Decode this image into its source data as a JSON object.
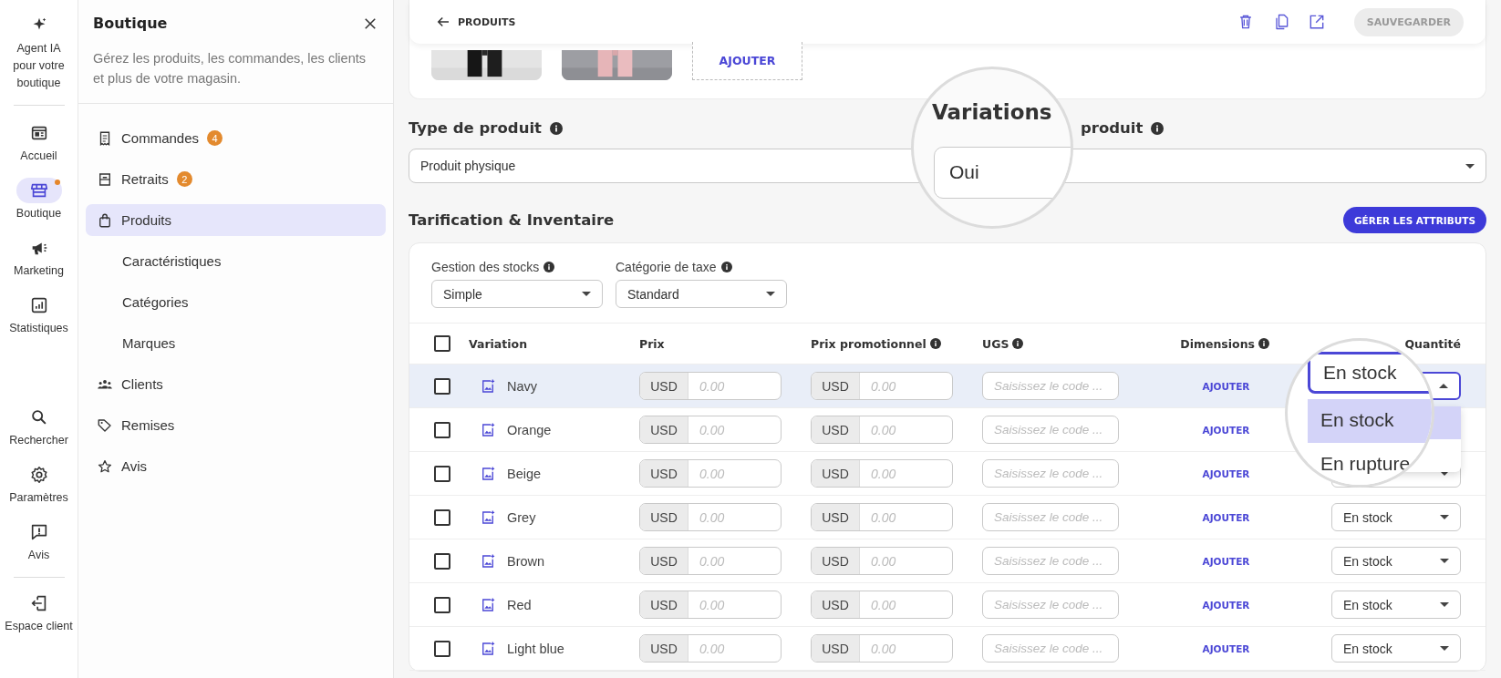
{
  "rail": {
    "sections": [
      [
        {
          "label": "Agent IA pour votre boutique",
          "selected": false
        }
      ],
      [
        {
          "label": "Accueil",
          "selected": false
        },
        {
          "label": "Boutique",
          "selected": true,
          "dot": true
        },
        {
          "label": "Marketing",
          "selected": false
        },
        {
          "label": "Statistiques",
          "selected": false
        }
      ],
      [
        {
          "label": "Rechercher",
          "selected": false
        },
        {
          "label": "Paramètres",
          "selected": false
        },
        {
          "label": "Avis",
          "selected": false
        }
      ],
      [
        {
          "label": "Espace client",
          "selected": false
        }
      ]
    ]
  },
  "panel": {
    "title": "Boutique",
    "description": "Gérez les produits, les commandes, les clients et plus de votre magasin.",
    "items": [
      {
        "label": "Commandes",
        "badge": "4",
        "selected": false
      },
      {
        "label": "Retraits",
        "badge": "2",
        "selected": false
      },
      {
        "label": "Produits",
        "selected": true,
        "children": [
          {
            "label": "Caractéristiques",
            "selected": false
          },
          {
            "label": "Catégories",
            "selected": false
          },
          {
            "label": "Marques",
            "selected": false
          }
        ]
      },
      {
        "label": "Clients",
        "selected": false
      },
      {
        "label": "Remises",
        "selected": false
      },
      {
        "label": "Avis",
        "selected": false
      }
    ]
  },
  "topbar": {
    "back_label": "PRODUITS",
    "save_button": {
      "label": "SAUVEGARDER",
      "disabled": true
    }
  },
  "media": {
    "add_label": "AJOUTER"
  },
  "product_type": {
    "label": "Type de produit",
    "value": "Produit physique",
    "second_label": "produit"
  },
  "variations_magnifier": {
    "label": "Variations",
    "value": "Oui"
  },
  "pricing": {
    "title": "Tarification & Inventaire",
    "manage_button": "GÉRER LES ATTRIBUTS",
    "stock_management": {
      "label": "Gestion des stocks",
      "value": "Simple"
    },
    "tax_category": {
      "label": "Catégorie de taxe",
      "value": "Standard"
    },
    "columns": [
      {
        "label": "Variation"
      },
      {
        "label": "Prix"
      },
      {
        "label": "Prix promotionnel",
        "info": true
      },
      {
        "label": "UGS",
        "info": true
      },
      {
        "label": "Dimensions",
        "info": true
      },
      {
        "label": "Quantité"
      }
    ],
    "header_checked": false,
    "rows": [
      {
        "name": "Navy",
        "checked": false,
        "highlighted": true,
        "currency": "USD",
        "price_placeholder": "0.00",
        "promo_currency": "USD",
        "promo_placeholder": "0.00",
        "sku_placeholder": "Saisissez le code ...",
        "dimensions": "AJOUTER",
        "quantity_open": true
      },
      {
        "name": "Orange",
        "checked": false,
        "currency": "USD",
        "price_placeholder": "0.00",
        "promo_currency": "USD",
        "promo_placeholder": "0.00",
        "sku_placeholder": "Saisissez le code ...",
        "dimensions": "AJOUTER"
      },
      {
        "name": "Beige",
        "checked": false,
        "currency": "USD",
        "price_placeholder": "0.00",
        "promo_currency": "USD",
        "promo_placeholder": "0.00",
        "sku_placeholder": "Saisissez le code ...",
        "dimensions": "AJOUTER"
      },
      {
        "name": "Grey",
        "checked": false,
        "currency": "USD",
        "price_placeholder": "0.00",
        "promo_currency": "USD",
        "promo_placeholder": "0.00",
        "sku_placeholder": "Saisissez le code ...",
        "dimensions": "AJOUTER",
        "quantity": "En stock"
      },
      {
        "name": "Brown",
        "checked": false,
        "currency": "USD",
        "price_placeholder": "0.00",
        "promo_currency": "USD",
        "promo_placeholder": "0.00",
        "sku_placeholder": "Saisissez le code ...",
        "dimensions": "AJOUTER",
        "quantity": "En stock"
      },
      {
        "name": "Red",
        "checked": false,
        "currency": "USD",
        "price_placeholder": "0.00",
        "promo_currency": "USD",
        "promo_placeholder": "0.00",
        "sku_placeholder": "Saisissez le code ...",
        "dimensions": "AJOUTER",
        "quantity": "En stock"
      },
      {
        "name": "Light blue",
        "checked": false,
        "currency": "USD",
        "price_placeholder": "0.00",
        "promo_currency": "USD",
        "promo_placeholder": "0.00",
        "sku_placeholder": "Saisissez le code ...",
        "dimensions": "AJOUTER",
        "quantity": "En stock"
      }
    ]
  },
  "quantity_magnifier": {
    "value": "En stock",
    "options": [
      {
        "label": "En stock",
        "selected": true
      },
      {
        "label": "En rupture",
        "selected": false
      }
    ]
  }
}
